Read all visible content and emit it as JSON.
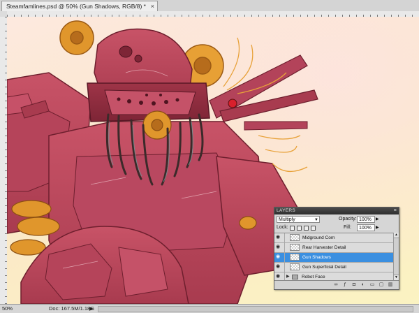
{
  "document": {
    "tab_title": "Steamfamlines.psd @ 50% (Gun Shadows, RGB/8) *",
    "close_glyph": "×"
  },
  "status": {
    "zoom": "50%",
    "doc_info": "Doc: 167.5M/1.18G",
    "arrow": "▶"
  },
  "layers_panel": {
    "title": "LAYERS",
    "menu_glyph": "≡",
    "blend_mode": "Multiply",
    "opacity_label": "Opacity:",
    "opacity_value": "100%",
    "lock_label": "Lock:",
    "fill_label": "Fill:",
    "fill_value": "100%",
    "layers": [
      {
        "name": "Midground Corn",
        "visible": true,
        "selected": false,
        "type": "layer"
      },
      {
        "name": "Rear Harvester Detail",
        "visible": true,
        "selected": false,
        "type": "layer"
      },
      {
        "name": "Gun Shadows",
        "visible": true,
        "selected": true,
        "type": "layer"
      },
      {
        "name": "Gun Superficial Detail",
        "visible": true,
        "selected": false,
        "type": "layer"
      },
      {
        "name": "Robot Face",
        "visible": true,
        "selected": false,
        "type": "group"
      }
    ],
    "footer_icons": [
      "link-icon",
      "fx-icon",
      "mask-icon",
      "adjustment-icon",
      "folder-icon",
      "new-layer-icon",
      "trash-icon"
    ]
  },
  "colors": {
    "selection": "#3b8fe0",
    "robot_body": "#c24a5e",
    "gears": "#e0962c",
    "canvas_bg": "#fbeccb"
  }
}
